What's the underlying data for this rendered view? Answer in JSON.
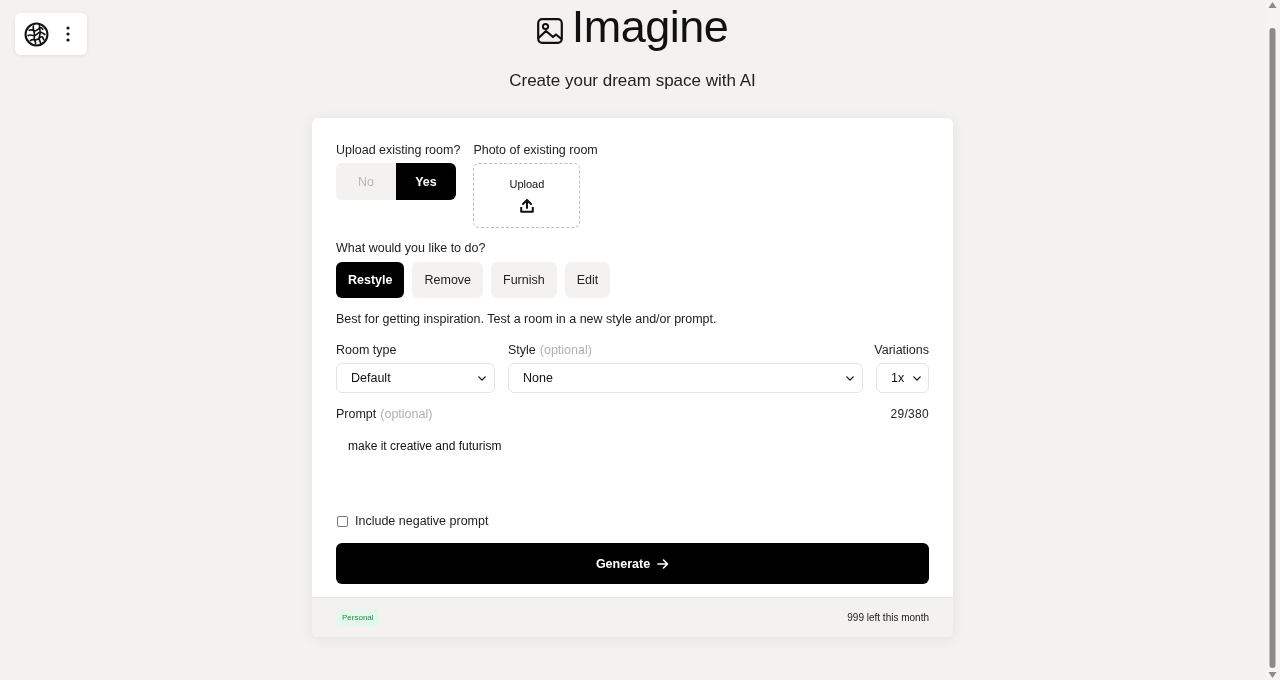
{
  "header": {
    "title": "Imagine",
    "subtitle": "Create your dream space with AI"
  },
  "form": {
    "upload_toggle": {
      "label": "Upload existing room?",
      "options": [
        {
          "label": "No",
          "selected": false
        },
        {
          "label": "Yes",
          "selected": true
        }
      ]
    },
    "photo_upload": {
      "label": "Photo of existing room",
      "button": "Upload"
    },
    "action": {
      "label": "What would you like to do?",
      "options": [
        {
          "label": "Restyle",
          "selected": true
        },
        {
          "label": "Remove",
          "selected": false
        },
        {
          "label": "Furnish",
          "selected": false
        },
        {
          "label": "Edit",
          "selected": false
        }
      ]
    },
    "description": "Best for getting inspiration. Test a room in a new style and/or prompt.",
    "selects": [
      {
        "label": "Room type",
        "value": "Default",
        "kind": "narrow"
      },
      {
        "label": "Style",
        "hint": "(optional)",
        "value": "None",
        "kind": "wide"
      },
      {
        "label": "Variations",
        "value": "1x",
        "kind": "compact"
      }
    ],
    "prompt": {
      "label": "Prompt",
      "hint": "(optional)",
      "counter": "29/380",
      "value": "make it creative and futurism"
    },
    "negative_prompt": {
      "label": "Include negative prompt",
      "checked": false
    },
    "generate_button": "Generate"
  },
  "footer": {
    "plan_badge": "Personal",
    "usage": "999 left this month"
  }
}
